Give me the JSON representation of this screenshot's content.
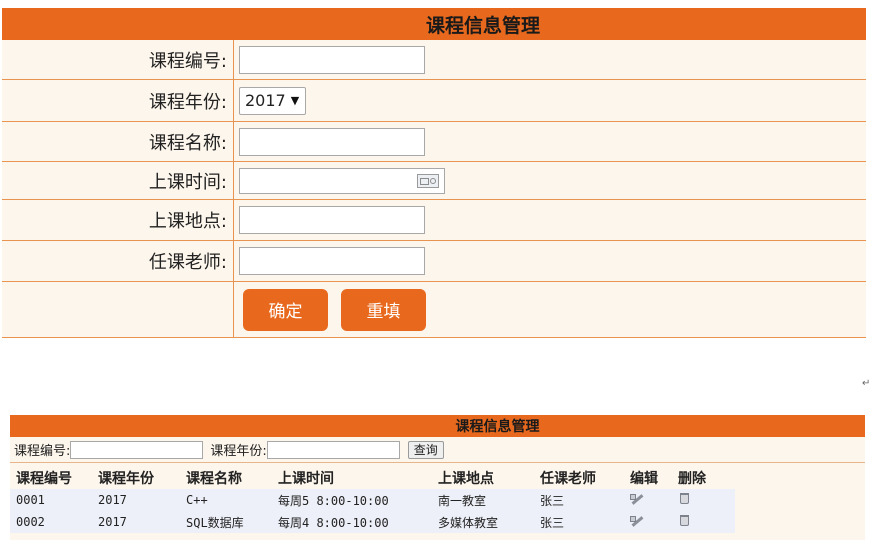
{
  "form": {
    "title": "课程信息管理",
    "fields": {
      "course_no": {
        "label": "课程编号:",
        "value": ""
      },
      "course_year": {
        "label": "课程年份:",
        "value": "2017"
      },
      "course_name": {
        "label": "课程名称:",
        "value": ""
      },
      "class_time": {
        "label": "上课时间:",
        "value": ""
      },
      "class_place": {
        "label": "上课地点:",
        "value": ""
      },
      "teacher": {
        "label": "任课老师:",
        "value": ""
      }
    },
    "confirm_label": "确定",
    "reset_label": "重填"
  },
  "list": {
    "title": "课程信息管理",
    "search": {
      "course_no_label": "课程编号:",
      "course_year_label": "课程年份:",
      "query_label": "查询"
    },
    "columns": [
      "课程编号",
      "课程年份",
      "课程名称",
      "上课时间",
      "上课地点",
      "任课老师",
      "编辑",
      "删除"
    ],
    "rows": [
      {
        "no": "0001",
        "year": "2017",
        "name": "C++",
        "time": "每周5 8:00-10:00",
        "place": "南一教室",
        "teacher": "张三"
      },
      {
        "no": "0002",
        "year": "2017",
        "name": "SQL数据库",
        "time": "每周4 8:00-10:00",
        "place": "多媒体教室",
        "teacher": "张三"
      }
    ]
  },
  "icons": {
    "edit": "edit-icon",
    "delete": "delete-icon",
    "calendar": "calendar-icon"
  },
  "colors": {
    "accent": "#e8691d",
    "row_bg": "#fdf6ec",
    "table_row_bg": "#edf0f8"
  },
  "pilcrow": "↵"
}
